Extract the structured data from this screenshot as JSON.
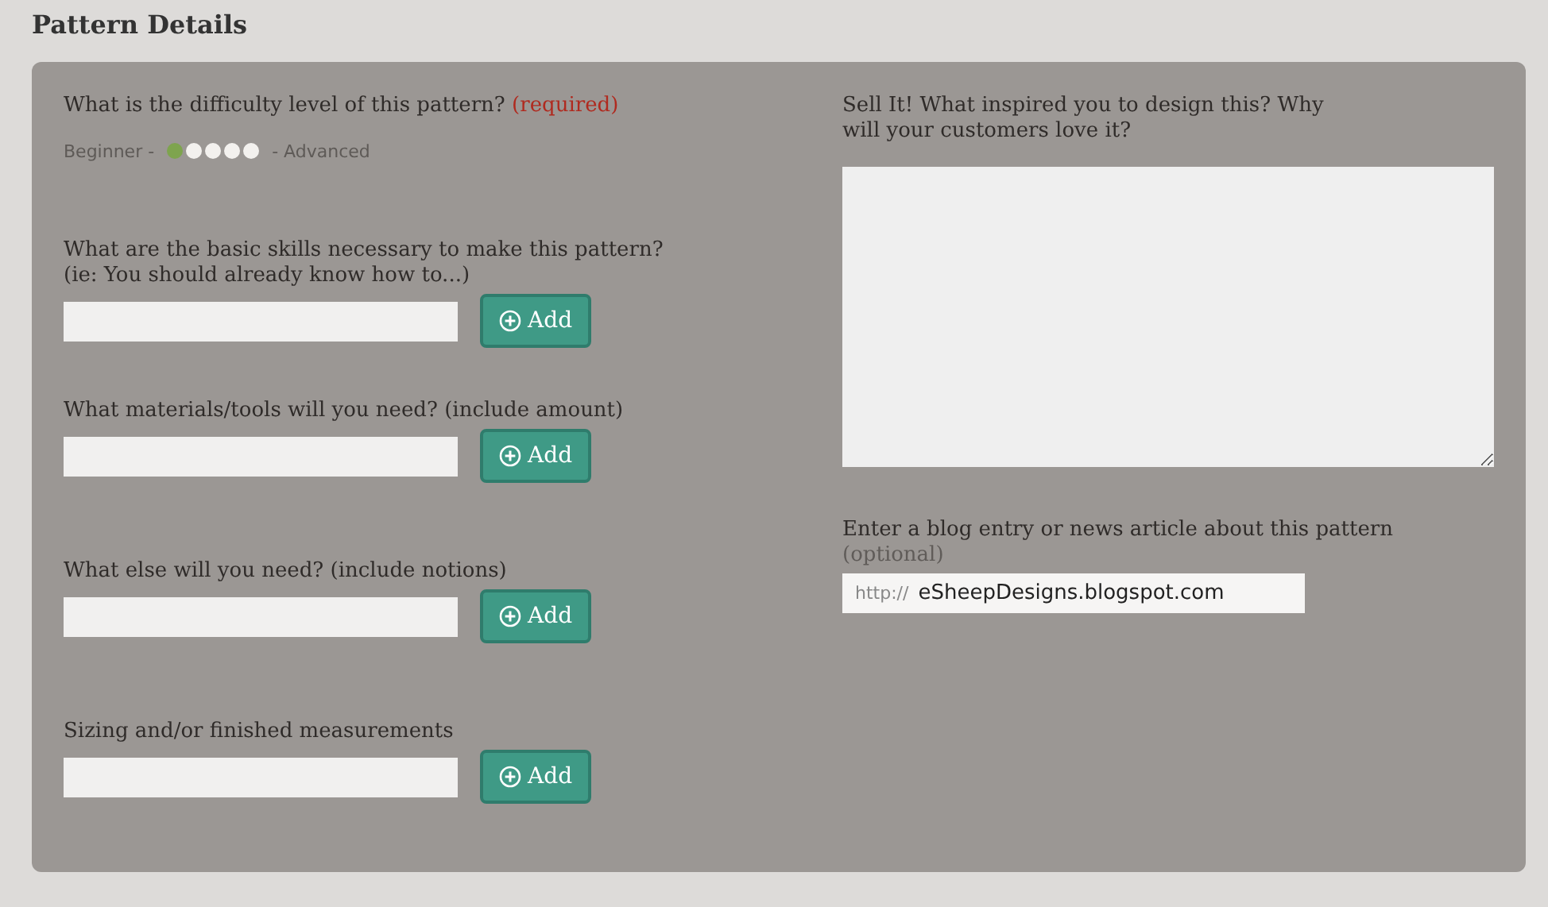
{
  "section_title": "Pattern Details",
  "difficulty": {
    "question": "What is the difficulty level of this pattern?",
    "required_note": "(required)",
    "low_label": "Beginner -",
    "high_label": "- Advanced",
    "dots": [
      {
        "selected": true
      },
      {
        "selected": false
      },
      {
        "selected": false
      },
      {
        "selected": false
      },
      {
        "selected": false
      }
    ]
  },
  "lists": [
    {
      "lines": [
        "What are the basic skills necessary to make this pattern?",
        "(ie: You should already know how to...)"
      ],
      "button": "Add"
    },
    {
      "lines": [
        "What materials/tools will you need? (include amount)"
      ],
      "button": "Add"
    },
    {
      "lines": [
        "What else will you need? (include notions)"
      ],
      "button": "Add"
    },
    {
      "lines": [
        "Sizing and/or finished measurements"
      ],
      "button": "Add"
    }
  ],
  "sell": {
    "lines": [
      "Sell It! What inspired you to design this? Why",
      "will your customers love it?"
    ]
  },
  "blog": {
    "question": "Enter a blog entry or news article about this pattern",
    "optional_note": "(optional)",
    "prefix": "http://",
    "value": "eSheepDesigns.blogspot.com"
  }
}
